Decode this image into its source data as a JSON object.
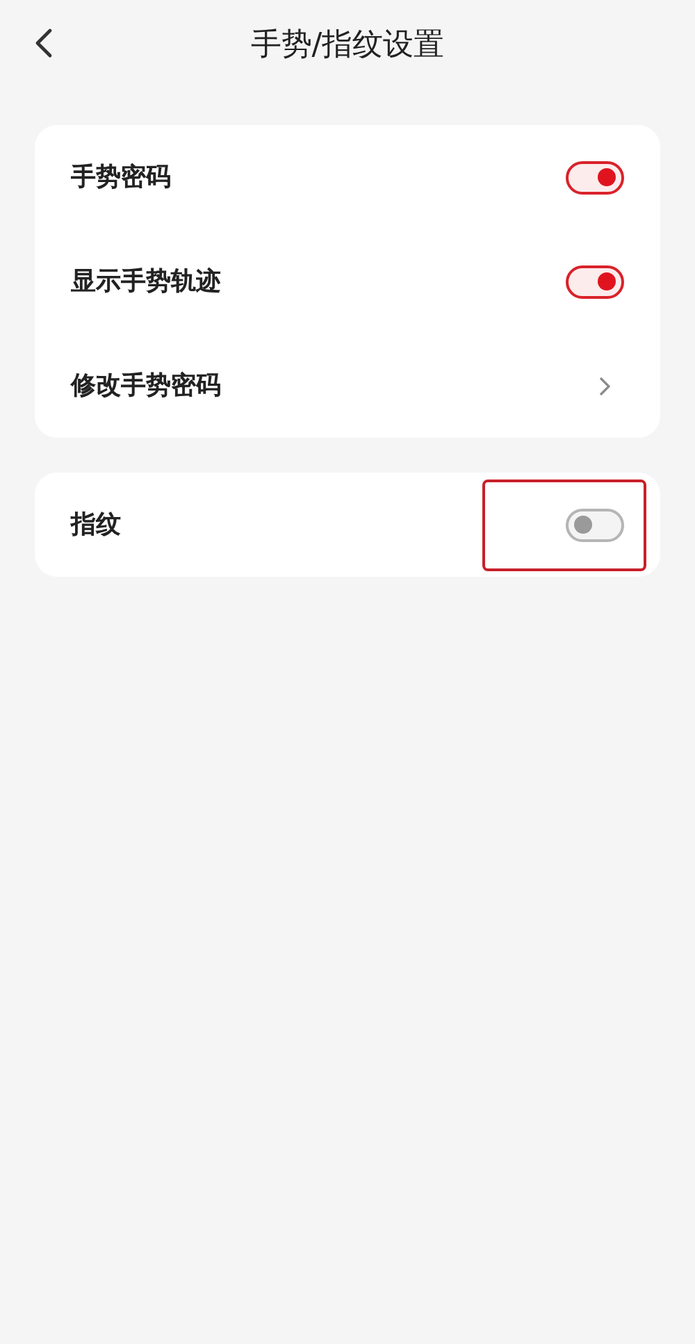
{
  "header": {
    "title": "手势/指纹设置"
  },
  "groups": [
    {
      "items": [
        {
          "kind": "toggle",
          "label": "手势密码",
          "on": true,
          "highlighted": false
        },
        {
          "kind": "toggle",
          "label": "显示手势轨迹",
          "on": true,
          "highlighted": false
        },
        {
          "kind": "link",
          "label": "修改手势密码"
        }
      ]
    },
    {
      "items": [
        {
          "kind": "toggle",
          "label": "指纹",
          "on": false,
          "highlighted": true
        }
      ]
    }
  ]
}
